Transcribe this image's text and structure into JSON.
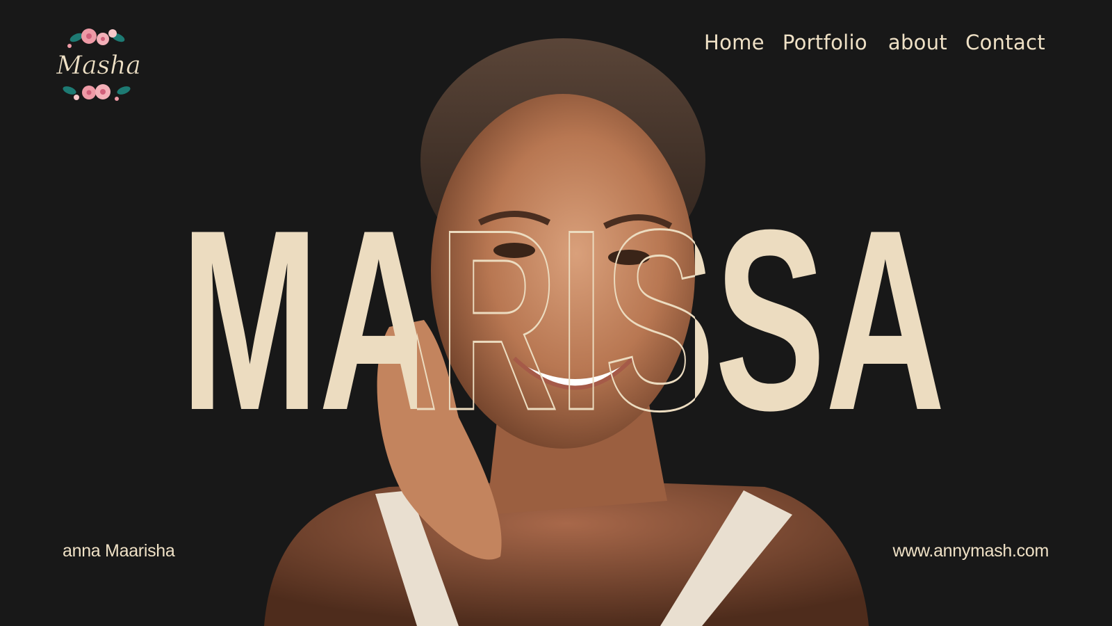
{
  "logo": {
    "text": "Masha",
    "name_hint": "MASHA"
  },
  "nav": {
    "items": [
      "Home",
      "Portfolio",
      "about",
      "Contact"
    ]
  },
  "hero": {
    "title": "MARISSA"
  },
  "footer": {
    "name": "anna Maarisha",
    "url": "www.annymash.com"
  },
  "colors": {
    "background": "#181818",
    "cream": "#ecdcc0",
    "text": "#efe1c6"
  }
}
